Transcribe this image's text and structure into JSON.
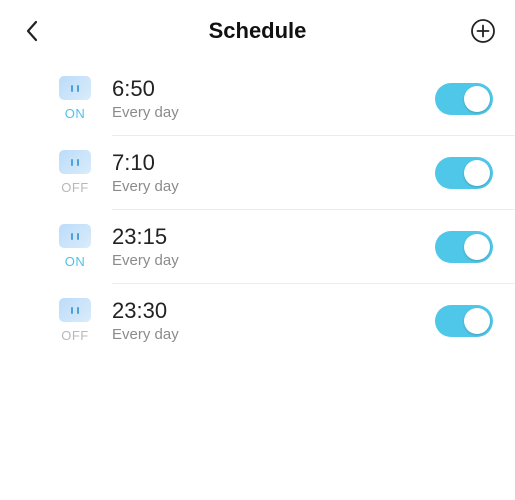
{
  "header": {
    "title": "Schedule"
  },
  "colors": {
    "accent": "#4fc7e8",
    "muted": "#8b8b8b",
    "on": "#4fc1e9",
    "off": "#b8b8b8"
  },
  "items": [
    {
      "time": "6:50",
      "repeat": "Every day",
      "state": "ON",
      "enabled": true
    },
    {
      "time": "7:10",
      "repeat": "Every day",
      "state": "OFF",
      "enabled": true
    },
    {
      "time": "23:15",
      "repeat": "Every day",
      "state": "ON",
      "enabled": true
    },
    {
      "time": "23:30",
      "repeat": "Every day",
      "state": "OFF",
      "enabled": true
    }
  ]
}
